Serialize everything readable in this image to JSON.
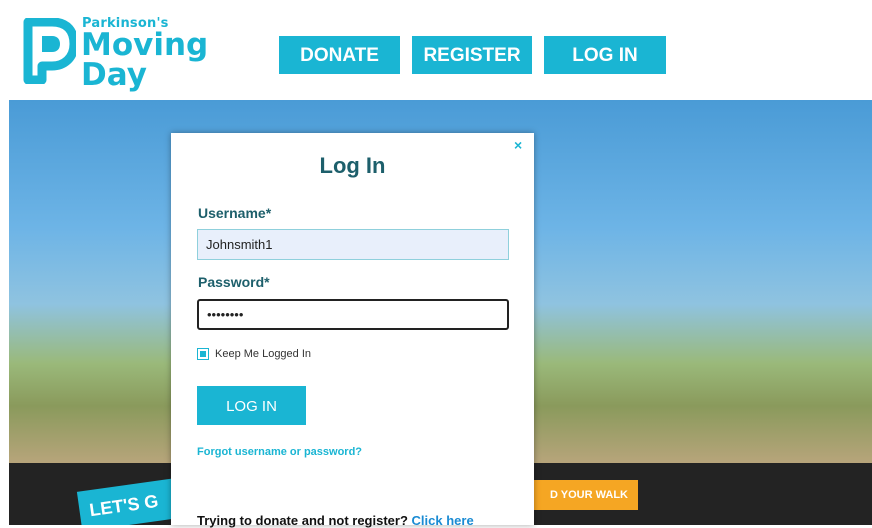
{
  "logo": {
    "line1": "Parkinson's",
    "line2": "Moving",
    "line3": "Day"
  },
  "nav": {
    "donate": "DONATE",
    "register": "REGISTER",
    "login": "LOG IN"
  },
  "hero": {
    "tagline": "LET'S G",
    "cta": "D YOUR WALK"
  },
  "modal": {
    "close": "×",
    "title": "Log In",
    "username_label": "Username*",
    "username_value": "Johnsmith1",
    "password_label": "Password*",
    "password_value": "••••••••",
    "keep_logged_in": "Keep Me Logged In",
    "keep_logged_in_checked": true,
    "login_button": "LOG IN",
    "forgot_link": "Forgot username or password?",
    "donate_prompt": "Trying to donate and not register?",
    "donate_link": "Click here"
  },
  "colors": {
    "brand": "#1ab5d3",
    "heading": "#1d5f6b",
    "cta": "#f5a623"
  }
}
